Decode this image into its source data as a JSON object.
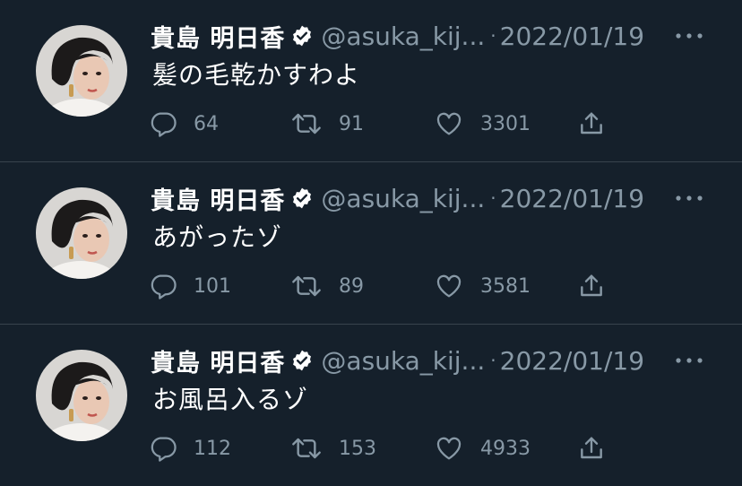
{
  "colors": {
    "background": "#15202b",
    "divider": "#38444d",
    "primary_text": "#ffffff",
    "secondary_text": "#8899a6"
  },
  "icons": {
    "verified": "verified-badge-icon",
    "more": "more-dots-icon",
    "reply": "reply-bubble-icon",
    "retweet": "retweet-arrows-icon",
    "like": "heart-outline-icon",
    "share": "share-upload-icon",
    "avatar": "profile-photo-avatar"
  },
  "tweets": [
    {
      "name": "貴島 明日香",
      "handle": "@asuka_kij...",
      "separator": "·",
      "date": "2022/01/19",
      "text": "髪の毛乾かすわよ",
      "replies": "64",
      "retweets": "91",
      "likes": "3301"
    },
    {
      "name": "貴島 明日香",
      "handle": "@asuka_kij...",
      "separator": "·",
      "date": "2022/01/19",
      "text": "あがったゾ",
      "replies": "101",
      "retweets": "89",
      "likes": "3581"
    },
    {
      "name": "貴島 明日香",
      "handle": "@asuka_kij...",
      "separator": "·",
      "date": "2022/01/19",
      "text": "お風呂入るゾ",
      "replies": "112",
      "retweets": "153",
      "likes": "4933"
    }
  ]
}
